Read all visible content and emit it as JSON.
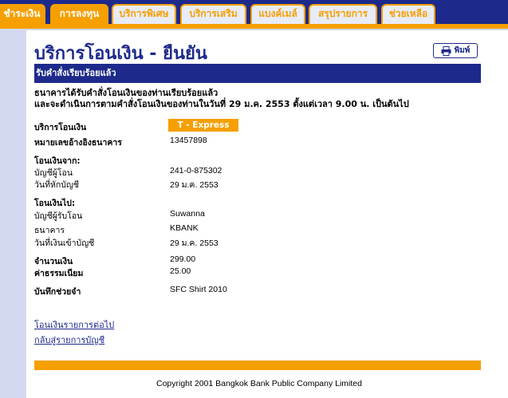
{
  "tabs": [
    {
      "label": "ชำระเงิน",
      "active": true
    },
    {
      "label": "การลงทุน",
      "active": true
    },
    {
      "label": "บริการพิเศษ",
      "active": false
    },
    {
      "label": "บริการเสริม",
      "active": false
    },
    {
      "label": "แบงค์เมล์",
      "active": false
    },
    {
      "label": "สรุปรายการ",
      "active": false
    },
    {
      "label": "ช่วยเหลือ",
      "active": false
    }
  ],
  "page_title": "บริการโอนเงิน - ยืนยัน",
  "print_label": "พิมพ์",
  "header_bar": "รับคำสั่งเรียบร้อยแล้ว",
  "confirm_line1": "ธนาคารได้รับคำสั่งโอนเงินของท่านเรียบร้อยแล้ว",
  "confirm_line2": "และจะดำเนินการตามคำสั่งโอนเงินของท่านในวันที่ 29 ม.ค. 2553 ตั้งแต่เวลา 9.00 น. เป็นต้นไป",
  "details": {
    "service_label": "บริการโอนเงิน",
    "service_value": "T - Express",
    "ref_label": "หมายเลขอ้างอิงธนาคาร",
    "ref_value": "13457898",
    "from_heading": "โอนเงินจาก:",
    "from_account_label": "บัญชีผู้โอน",
    "from_account_value": "241-0-875302",
    "debit_date_label": "วันที่หักบัญชี",
    "debit_date_value": "29 ม.ค. 2553",
    "to_heading": "โอนเงินไป:",
    "to_account_label": "บัญชีผู้รับโอน",
    "to_account_value": "Suwanna",
    "bank_label": "ธนาคาร",
    "bank_value": "KBANK",
    "credit_date_label": "วันที่เงินเข้าบัญชี",
    "credit_date_value": "29 ม.ค. 2553",
    "amount_label": "จำนวนเงิน",
    "amount_value": "299.00",
    "fee_label": "ค่าธรรมเนียม",
    "fee_value": "25.00",
    "memo_label": "บันทึกช่วยจำ",
    "memo_value": "SFC Shirt 2010"
  },
  "links": {
    "next_transfer": "โอนเงินรายการต่อไป",
    "back_to_accounts": "กลับสู่รายการบัญชี"
  },
  "copyright": "Copyright 2001 Bangkok Bank Public Company Limited",
  "colors": {
    "navy": "#1d2a8c",
    "orange": "#f5a000",
    "lavender": "#d3d9f0"
  }
}
